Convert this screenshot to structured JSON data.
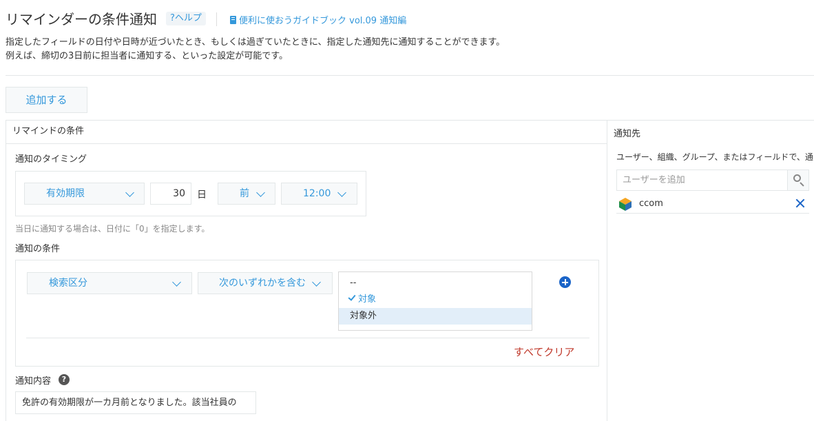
{
  "header": {
    "title": "リマインダーの条件通知",
    "help_label": "?ヘルプ",
    "guide_label": "便利に使おうガイドブック vol.09 通知編"
  },
  "description": {
    "line1": "指定したフィールドの日付や日時が近づいたとき、もしくは過ぎていたときに、指定した通知先に通知することができます。",
    "line2": "例えば、締切の3日前に担当者に通知する、といった設定が可能です。"
  },
  "add_button_label": "追加する",
  "conditions": {
    "header": "リマインドの条件",
    "timing": {
      "label": "通知のタイミング",
      "field_select": "有効期限",
      "days_value": "30",
      "days_unit": "日",
      "direction_select": "前",
      "time_select": "12:00",
      "hint": "当日に通知する場合は、日付に「0」を指定します。"
    },
    "filter": {
      "label": "通知の条件",
      "field_select": "検索区分",
      "operator_select": "次のいずれかを含む",
      "options": [
        {
          "label": "--",
          "state": "normal"
        },
        {
          "label": "対象",
          "state": "selected"
        },
        {
          "label": "対象外",
          "state": "highlighted"
        }
      ],
      "clear_all_label": "すべてクリア"
    },
    "content": {
      "label": "通知内容",
      "value": "免許の有効期限が一カ月前となりました。該当社員の"
    }
  },
  "notify": {
    "header": "通知先",
    "description": "ユーザー、組織、グループ、またはフィールドで、通",
    "search_placeholder": "ユーザーを追加",
    "entries": [
      {
        "name": "ccom",
        "icon": "organization-icon"
      }
    ]
  },
  "colors": {
    "accent": "#3498db",
    "danger": "#c0392b",
    "icon_blue": "#1a64c8"
  }
}
